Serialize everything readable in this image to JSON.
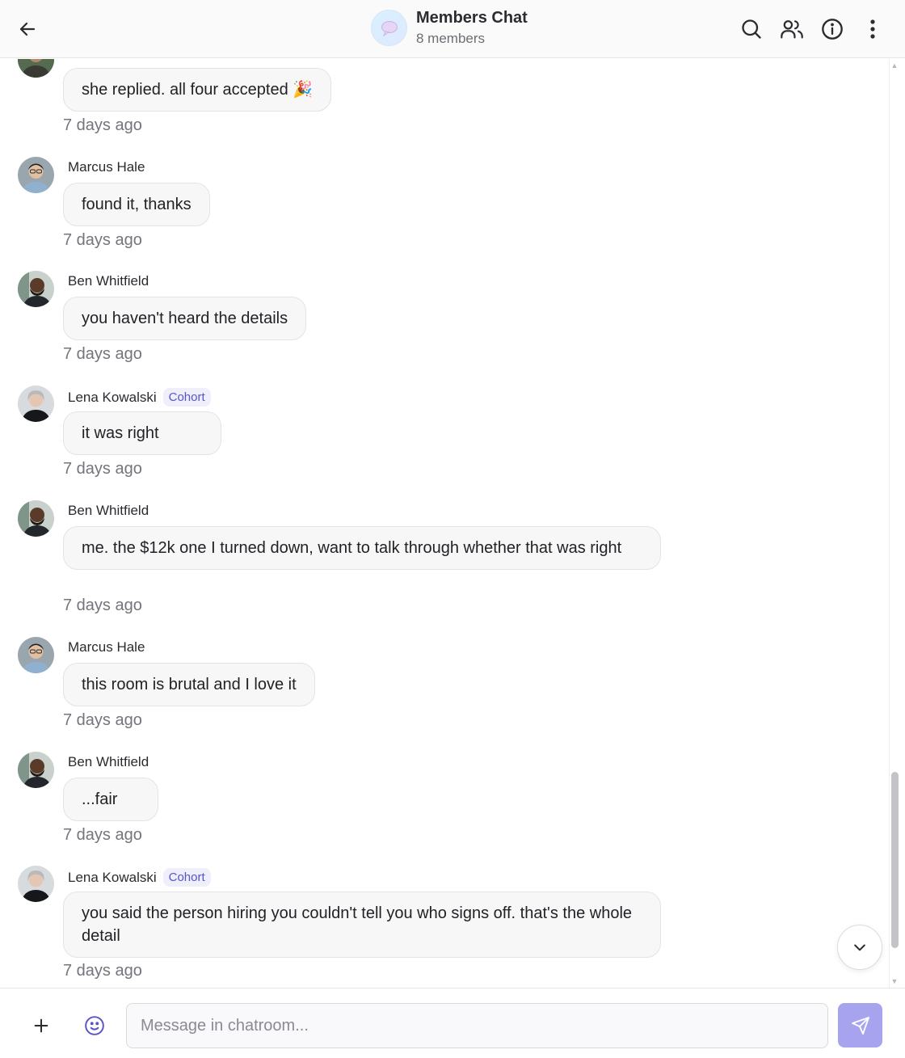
{
  "header": {
    "title": "Members Chat",
    "subtitle": "8 members",
    "icons": [
      "back-arrow-icon",
      "search-icon",
      "members-icon",
      "info-icon",
      "more-vertical-icon"
    ]
  },
  "badge_label": "Cohort",
  "messages": [
    {
      "sender": "",
      "badge": "",
      "text": "she replied. all four accepted 🎉",
      "time": "7 days ago"
    },
    {
      "sender": "Marcus Hale",
      "badge": "",
      "text": "found it, thanks",
      "time": "7 days ago"
    },
    {
      "sender": "Ben Whitfield",
      "badge": "",
      "text": "you haven't heard the details",
      "time": "7 days ago"
    },
    {
      "sender": "Lena Kowalski",
      "badge": "Cohort",
      "text": "it was right",
      "time": "7 days ago"
    },
    {
      "sender": "Ben Whitfield",
      "badge": "",
      "text": "me. the $12k one I turned down, want to talk through whether that was right",
      "time": "7 days ago"
    },
    {
      "sender": "Marcus Hale",
      "badge": "",
      "text": "this room is brutal and I love it",
      "time": "7 days ago"
    },
    {
      "sender": "Ben Whitfield",
      "badge": "",
      "text": "...fair",
      "time": "7 days ago"
    },
    {
      "sender": "Lena Kowalski",
      "badge": "Cohort",
      "text": "you said the person hiring you couldn't tell you who signs off. that's the whole detail",
      "time": "7 days ago"
    }
  ],
  "composer": {
    "placeholder": "Message in chatroom..."
  },
  "colors": {
    "accent": "#a7a3ef",
    "badge_text": "#5a54c7",
    "badge_bg": "#efeefb",
    "bubble_bg": "#f7f7f8"
  }
}
